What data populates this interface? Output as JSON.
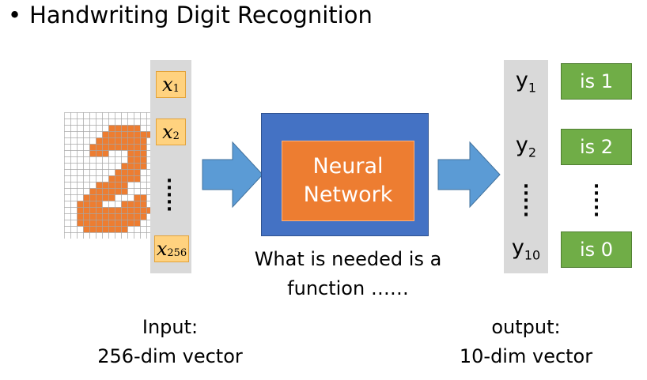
{
  "title": "Handwriting Digit Recognition",
  "inputs": [
    {
      "var": "x",
      "sub": "1"
    },
    {
      "var": "x",
      "sub": "2"
    },
    {
      "var": "x",
      "sub": "256"
    }
  ],
  "network": {
    "line1": "Neural",
    "line2": "Network"
  },
  "caption": {
    "line1": "What is needed is a",
    "line2": "function ……"
  },
  "input_caption": {
    "line1": "Input:",
    "line2": "256-dim vector"
  },
  "output_caption": {
    "line1": "output:",
    "line2": "10-dim vector"
  },
  "outputs": [
    {
      "var": "y",
      "sub": "1",
      "label": "is 1"
    },
    {
      "var": "y",
      "sub": "2",
      "label": "is 2"
    },
    {
      "var": "y",
      "sub": "10",
      "label": "is 0"
    }
  ],
  "colors": {
    "network_outer": "#4472c4",
    "network_inner": "#ed7d31",
    "arrow": "#5b9bd5",
    "input_cell": "#ffd27f",
    "output_label": "#70ad47",
    "digit_fill": "#ed7d31"
  }
}
